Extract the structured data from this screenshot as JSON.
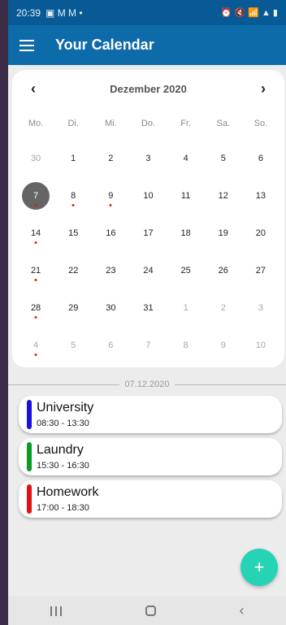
{
  "status": {
    "time": "20:39",
    "left_icons": "▣ M M •",
    "right_icons": "⏰ 🔇 📶 ▲ ▮"
  },
  "app": {
    "title": "Your Calendar"
  },
  "calendar": {
    "month": "Dezember 2020",
    "prev": "‹",
    "next": "›",
    "weekdays": [
      "Mo.",
      "Di.",
      "Mi.",
      "Do.",
      "Fr.",
      "Sa.",
      "So."
    ],
    "days": [
      {
        "n": "30",
        "muted": true
      },
      {
        "n": "1"
      },
      {
        "n": "2"
      },
      {
        "n": "3"
      },
      {
        "n": "4"
      },
      {
        "n": "5"
      },
      {
        "n": "6"
      },
      {
        "n": "7",
        "selected": true,
        "dot": true
      },
      {
        "n": "8",
        "dot": true
      },
      {
        "n": "9",
        "dot": true
      },
      {
        "n": "10"
      },
      {
        "n": "11"
      },
      {
        "n": "12"
      },
      {
        "n": "13"
      },
      {
        "n": "14",
        "dot": true
      },
      {
        "n": "15"
      },
      {
        "n": "16"
      },
      {
        "n": "17"
      },
      {
        "n": "18"
      },
      {
        "n": "19"
      },
      {
        "n": "20"
      },
      {
        "n": "21",
        "dot": true
      },
      {
        "n": "22"
      },
      {
        "n": "23"
      },
      {
        "n": "24"
      },
      {
        "n": "25"
      },
      {
        "n": "26"
      },
      {
        "n": "27"
      },
      {
        "n": "28",
        "dot": true
      },
      {
        "n": "29"
      },
      {
        "n": "30"
      },
      {
        "n": "31"
      },
      {
        "n": "1",
        "muted": true
      },
      {
        "n": "2",
        "muted": true
      },
      {
        "n": "3",
        "muted": true
      },
      {
        "n": "4",
        "muted": true,
        "dot": true
      },
      {
        "n": "5",
        "muted": true
      },
      {
        "n": "6",
        "muted": true
      },
      {
        "n": "7",
        "muted": true
      },
      {
        "n": "8",
        "muted": true
      },
      {
        "n": "9",
        "muted": true
      },
      {
        "n": "10",
        "muted": true
      }
    ]
  },
  "selected_date": "07.12.2020",
  "events": [
    {
      "name": "University",
      "time": "08:30 - 13:30",
      "color": "#1a10e0"
    },
    {
      "name": "Laundry",
      "time": "15:30 - 16:30",
      "color": "#0c9c22"
    },
    {
      "name": "Homework",
      "time": "17:00 - 18:30",
      "color": "#e31212"
    }
  ],
  "fab_label": "+",
  "nav": {
    "back": "‹"
  },
  "colors": {
    "appbar": "#0d6ba9",
    "statusbar": "#075a95",
    "fab": "#27d3b5",
    "dot": "#e0211b"
  }
}
